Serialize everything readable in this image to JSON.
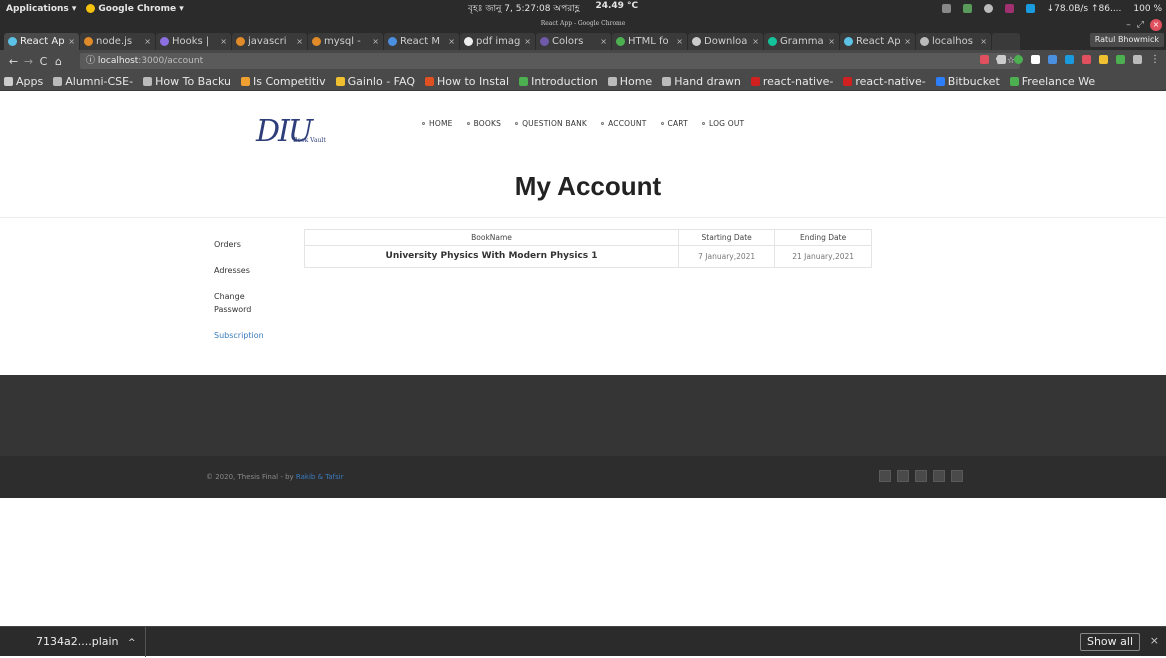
{
  "system": {
    "applications_menu": "Applications ▾",
    "chrome_menu": "Google Chrome ▾",
    "clock": "বৃহঃ জানু 7, 5:27:08 অপরাহ্ণ",
    "weather": "24.49 °C",
    "net_speed": "↓78.0B/s ↑86....",
    "battery": "100 %"
  },
  "window": {
    "title": "React App - Google Chrome"
  },
  "tabs": [
    {
      "label": "React Ap",
      "color": "#5cc3e6",
      "active": true
    },
    {
      "label": "node.js",
      "color": "#e08a2a"
    },
    {
      "label": "Hooks |",
      "color": "#8b6ee0"
    },
    {
      "label": "javascri",
      "color": "#e08a2a"
    },
    {
      "label": "mysql -",
      "color": "#e08a2a"
    },
    {
      "label": "React M",
      "color": "#4a8fe0"
    },
    {
      "label": "pdf imag",
      "color": "#eeeeee"
    },
    {
      "label": "Colors",
      "color": "#6e5aa8"
    },
    {
      "label": "HTML fo",
      "color": "#4caf50"
    },
    {
      "label": "Downloa",
      "color": "#cccccc"
    },
    {
      "label": "Gramma",
      "color": "#15c39a"
    },
    {
      "label": "React Ap",
      "color": "#5cc3e6"
    },
    {
      "label": "localhos",
      "color": "#bbbbbb"
    }
  ],
  "profile": "Ratul Bhowmick",
  "address": {
    "host": "localhost",
    "path": ":3000/account"
  },
  "bookmarks": [
    {
      "label": "Apps",
      "color": "#cccccc"
    },
    {
      "label": "Alumni-CSE-",
      "color": "#bbbbbb"
    },
    {
      "label": "How To Backu",
      "color": "#bbbbbb"
    },
    {
      "label": "Is Competitiv",
      "color": "#f0a030"
    },
    {
      "label": "Gainlo - FAQ",
      "color": "#f0c030"
    },
    {
      "label": "How to Instal",
      "color": "#e05020"
    },
    {
      "label": "Introduction",
      "color": "#4caf50"
    },
    {
      "label": "Home",
      "color": "#bbbbbb"
    },
    {
      "label": "Hand drawn",
      "color": "#bbbbbb"
    },
    {
      "label": "react-native-",
      "color": "#d02020"
    },
    {
      "label": "react-native-",
      "color": "#d02020"
    },
    {
      "label": "Bitbucket",
      "color": "#2d7ff9"
    },
    {
      "label": "Freelance We",
      "color": "#4caf50"
    }
  ],
  "logo": {
    "mark": "DIU",
    "sub": "Book Vault"
  },
  "nav": [
    "HOME",
    "BOOKS",
    "QUESTION BANK",
    "ACCOUNT",
    "CART",
    "LOG OUT"
  ],
  "page_title": "My Account",
  "side_menu": [
    {
      "label": "Orders"
    },
    {
      "label": "Adresses"
    },
    {
      "label": "Change Password"
    },
    {
      "label": "Subscription",
      "active": true
    }
  ],
  "table": {
    "headers": [
      "BookName",
      "Starting Date",
      "Ending Date"
    ],
    "rows": [
      [
        "University Physics With Modern Physics 1",
        "7 January,2021",
        "21 January,2021"
      ]
    ]
  },
  "footer": {
    "copyright_prefix": "© 2020, Thesis Final - by",
    "authors": "Rakib & Tafsir"
  },
  "download": {
    "file": "7134a2....plain",
    "show_all": "Show all"
  }
}
